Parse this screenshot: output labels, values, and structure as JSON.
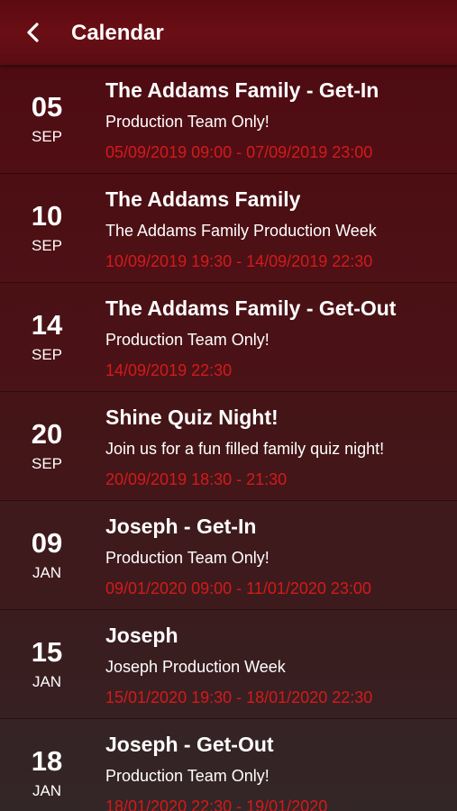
{
  "header": {
    "title": "Calendar",
    "back_icon": "chevron-left-icon"
  },
  "colors": {
    "header_bg": "#640d14",
    "time_text": "#d41a1a",
    "text": "#ffffff"
  },
  "events": [
    {
      "day": "05",
      "month": "SEP",
      "title": "The Addams Family - Get-In",
      "subtitle": "Production Team Only!",
      "time": "05/09/2019 09:00 - 07/09/2019 23:00"
    },
    {
      "day": "10",
      "month": "SEP",
      "title": "The Addams Family",
      "subtitle": "The Addams Family Production Week",
      "time": "10/09/2019 19:30 - 14/09/2019 22:30"
    },
    {
      "day": "14",
      "month": "SEP",
      "title": "The Addams Family - Get-Out",
      "subtitle": "Production Team Only!",
      "time": "14/09/2019 22:30"
    },
    {
      "day": "20",
      "month": "SEP",
      "title": "Shine Quiz Night!",
      "subtitle": "Join us for a fun filled family quiz night!",
      "time": "20/09/2019 18:30 - 21:30"
    },
    {
      "day": "09",
      "month": "JAN",
      "title": "Joseph - Get-In",
      "subtitle": "Production Team Only!",
      "time": "09/01/2020 09:00 - 11/01/2020 23:00"
    },
    {
      "day": "15",
      "month": "JAN",
      "title": "Joseph",
      "subtitle": "Joseph Production Week",
      "time": "15/01/2020 19:30 - 18/01/2020 22:30"
    },
    {
      "day": "18",
      "month": "JAN",
      "title": "Joseph - Get-Out",
      "subtitle": "Production Team Only!",
      "time": "18/01/2020 22:30 - 19/01/2020"
    }
  ]
}
